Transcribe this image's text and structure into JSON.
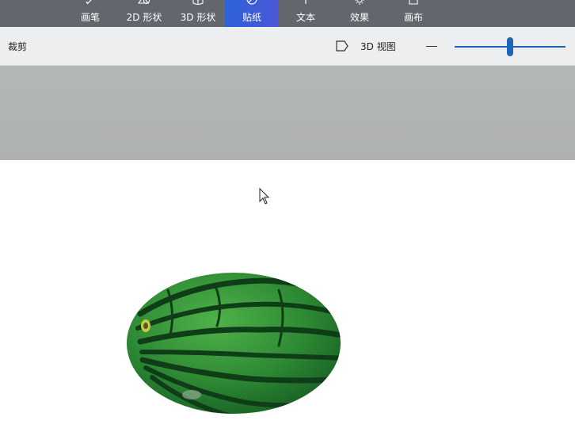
{
  "ribbon": {
    "tabs": [
      {
        "label": "画笔",
        "icon": "brush-icon"
      },
      {
        "label": "2D 形状",
        "icon": "shapes-2d-icon"
      },
      {
        "label": "3D 形状",
        "icon": "cube-3d-icon"
      },
      {
        "label": "贴纸",
        "icon": "sticker-icon",
        "active": true
      },
      {
        "label": "文本",
        "icon": "text-icon"
      },
      {
        "label": "效果",
        "icon": "effects-icon"
      },
      {
        "label": "画布",
        "icon": "canvas-icon"
      }
    ]
  },
  "toolbar": {
    "crop_label": "裁剪",
    "view3d_label": "3D 视图",
    "zoom_slider": {
      "value": 0.5
    }
  },
  "canvas": {
    "content_icon": "watermelon-sticker-icon",
    "cursor_icon": "mouse-pointer-icon"
  },
  "colors": {
    "ribbon_bg": "#63676d",
    "active_tab": "#2d62d6",
    "toolbar_bg": "#eceeef",
    "accent": "#1f66b8",
    "workspace_gray": "#b1b4b4"
  }
}
